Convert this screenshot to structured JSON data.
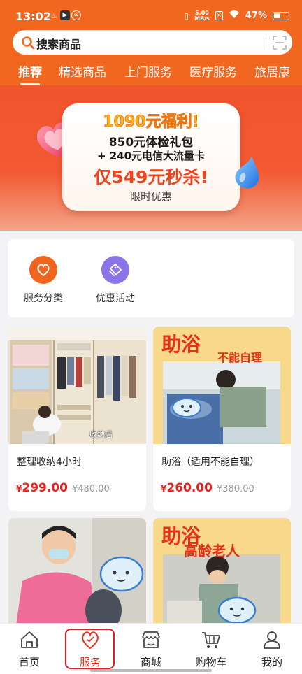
{
  "status_bar": {
    "time": "13:02",
    "net_speed_value": "5.00",
    "net_speed_unit": "MB/s",
    "battery_percent": "47%"
  },
  "search": {
    "placeholder": "搜索商品"
  },
  "tabs": [
    {
      "label": "推荐",
      "active": true
    },
    {
      "label": "精选商品",
      "active": false
    },
    {
      "label": "上门服务",
      "active": false
    },
    {
      "label": "医疗服务",
      "active": false
    },
    {
      "label": "旅居康",
      "active": false
    }
  ],
  "banner": {
    "title": "1090元福利!",
    "line1": "850元体检礼包",
    "line2": "+ 240元电信大流量卡",
    "price": "仅549元秒杀!",
    "subtitle": "限时优惠"
  },
  "quick_entries": [
    {
      "label": "服务分类",
      "icon": "heart-tag-icon",
      "color": "#f0641e"
    },
    {
      "label": "优惠活动",
      "icon": "coupon-icon",
      "color": "#8a74e8"
    }
  ],
  "products": [
    {
      "name": "整理收纳4小时",
      "price": "299.00",
      "original_price": "480.00",
      "image": "closet-organizing-photo",
      "image_caption": "收纳后"
    },
    {
      "name": "助浴（适用不能自理）",
      "price": "260.00",
      "original_price": "380.00",
      "image": "bath-assist-photo",
      "image_headline": "助浴",
      "image_subline": "不能自理"
    },
    {
      "image": "elderly-haircut-photo"
    },
    {
      "image": "bath-assist-elderly-photo",
      "image_headline": "助浴",
      "image_subline": "高龄老人"
    }
  ],
  "currency_symbol": "¥",
  "bottom_nav": [
    {
      "label": "首页",
      "icon": "home-icon",
      "active": false
    },
    {
      "label": "服务",
      "icon": "heart-icon",
      "active": true
    },
    {
      "label": "商城",
      "icon": "store-icon",
      "active": false
    },
    {
      "label": "购物车",
      "icon": "cart-icon",
      "active": false
    },
    {
      "label": "我的",
      "icon": "user-icon",
      "active": false
    }
  ],
  "colors": {
    "brand": "#f2671f",
    "price": "#e8241d",
    "highlight": "#e02020"
  }
}
